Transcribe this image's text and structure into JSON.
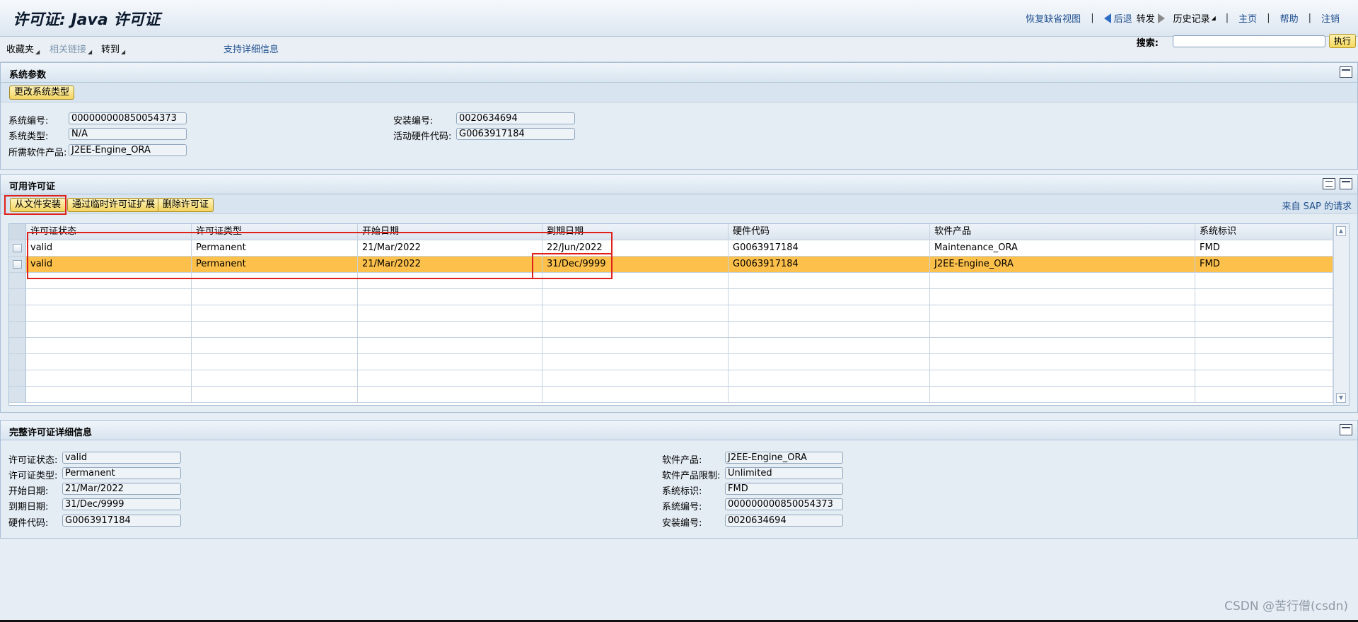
{
  "header": {
    "title": "许可证: Java 许可证",
    "links": {
      "restore_view": "恢复缺省视图",
      "back": "后退",
      "forward": "转发",
      "history": "历史记录",
      "home": "主页",
      "help": "帮助",
      "logout": "注销"
    }
  },
  "menubar": {
    "favorites": "收藏夹",
    "related_links": "相关链接",
    "goto": "转到",
    "support": "支持详细信息",
    "search_label": "搜索:",
    "search_value": "",
    "execute": "执行"
  },
  "system_params": {
    "title": "系统参数",
    "change_type_button": "更改系统类型",
    "fields": {
      "system_number_label": "系统编号:",
      "system_number": "000000000850054373",
      "system_type_label": "系统类型:",
      "system_type": "N/A",
      "software_product_label": "所需软件产品:",
      "software_product": "J2EE-Engine_ORA",
      "install_number_label": "安装编号:",
      "install_number": "0020634694",
      "hardware_key_label": "活动硬件代码:",
      "hardware_key": "G0063917184"
    }
  },
  "licenses": {
    "title": "可用许可证",
    "buttons": {
      "install_from_file": "从文件安装",
      "temp_extension": "通过临时许可证扩展",
      "delete": "删除许可证",
      "sap_request": "来自 SAP 的请求"
    },
    "columns": [
      "许可证状态",
      "许可证类型",
      "开始日期",
      "到期日期",
      "硬件代码",
      "软件产品",
      "系统标识"
    ],
    "rows": [
      [
        "valid",
        "Permanent",
        "21/Mar/2022",
        "22/Jun/2022",
        "G0063917184",
        "Maintenance_ORA",
        "FMD"
      ],
      [
        "valid",
        "Permanent",
        "21/Mar/2022",
        "31/Dec/9999",
        "G0063917184",
        "J2EE-Engine_ORA",
        "FMD"
      ]
    ]
  },
  "details": {
    "title": "完整许可证详细信息",
    "left": {
      "status_label": "许可证状态:",
      "status": "valid",
      "type_label": "许可证类型:",
      "type": "Permanent",
      "start_label": "开始日期:",
      "start": "21/Mar/2022",
      "end_label": "到期日期:",
      "end": "31/Dec/9999",
      "hw_label": "硬件代码:",
      "hw": "G0063917184"
    },
    "right": {
      "product_label": "软件产品:",
      "product": "J2EE-Engine_ORA",
      "limit_label": "软件产品限制:",
      "limit": "Unlimited",
      "sid_label": "系统标识:",
      "sid": "FMD",
      "sysno_label": "系统编号:",
      "sysno": "000000000850054373",
      "instno_label": "安装编号:",
      "instno": "0020634694"
    }
  },
  "watermark": "CSDN @苦行僧(csdn)",
  "colors": {
    "selected_row": "#fcc04b",
    "annotation_red": "#e0201a",
    "link_blue": "#1f4f8f"
  }
}
